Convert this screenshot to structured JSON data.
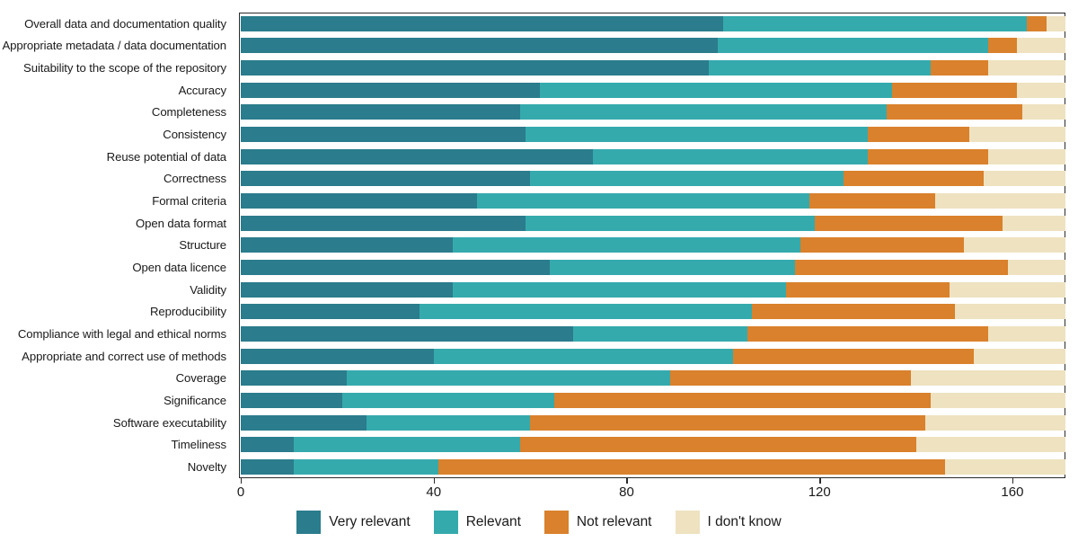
{
  "chart_data": {
    "type": "bar",
    "subtype": "stacked-horizontal",
    "title": "",
    "xlabel": "",
    "ylabel": "",
    "xlim": [
      0,
      171
    ],
    "xticks": [
      0,
      40,
      80,
      120,
      160
    ],
    "xtick_labels": [
      "0",
      "40",
      "80",
      "120",
      "160"
    ],
    "grid": false,
    "legend_position": "bottom-center",
    "orientation": "horizontal",
    "bar_total": 171,
    "categories": [
      "Overall data and documentation quality",
      "Appropriate metadata / data documentation",
      "Suitability to the scope of the repository",
      "Accuracy",
      "Completeness",
      "Consistency",
      "Reuse potential of data",
      "Correctness",
      "Formal criteria",
      "Open data format",
      "Structure",
      "Open data licence",
      "Validity",
      "Reproducibility",
      "Compliance with legal and ethical norms",
      "Appropriate and correct use of methods",
      "Coverage",
      "Significance",
      "Software executability",
      "Timeliness",
      "Novelty"
    ],
    "series": [
      {
        "name": "Very relevant",
        "color": "#2b7c8c",
        "values": [
          100,
          99,
          97,
          62,
          58,
          59,
          73,
          60,
          49,
          59,
          44,
          64,
          44,
          37,
          69,
          40,
          22,
          21,
          26,
          11,
          11
        ]
      },
      {
        "name": "Relevant",
        "color": "#35aaad",
        "values": [
          63,
          56,
          46,
          73,
          76,
          71,
          57,
          65,
          69,
          60,
          72,
          51,
          69,
          69,
          36,
          62,
          67,
          44,
          34,
          47,
          30
        ]
      },
      {
        "name": "Not relevant",
        "color": "#d9812c",
        "values": [
          4,
          6,
          12,
          26,
          28,
          21,
          25,
          29,
          26,
          39,
          34,
          44,
          34,
          42,
          50,
          50,
          50,
          78,
          82,
          82,
          105
        ]
      },
      {
        "name": "I don't know",
        "color": "#eee2c0",
        "values": [
          4,
          10,
          16,
          10,
          9,
          20,
          16,
          17,
          27,
          13,
          21,
          12,
          24,
          23,
          16,
          19,
          32,
          28,
          29,
          31,
          25
        ]
      }
    ],
    "legend": [
      {
        "label": "Very relevant",
        "color": "#2b7c8c"
      },
      {
        "label": "Relevant",
        "color": "#35aaad"
      },
      {
        "label": "Not relevant",
        "color": "#d9812c"
      },
      {
        "label": "I don't know",
        "color": "#eee2c0"
      }
    ]
  }
}
